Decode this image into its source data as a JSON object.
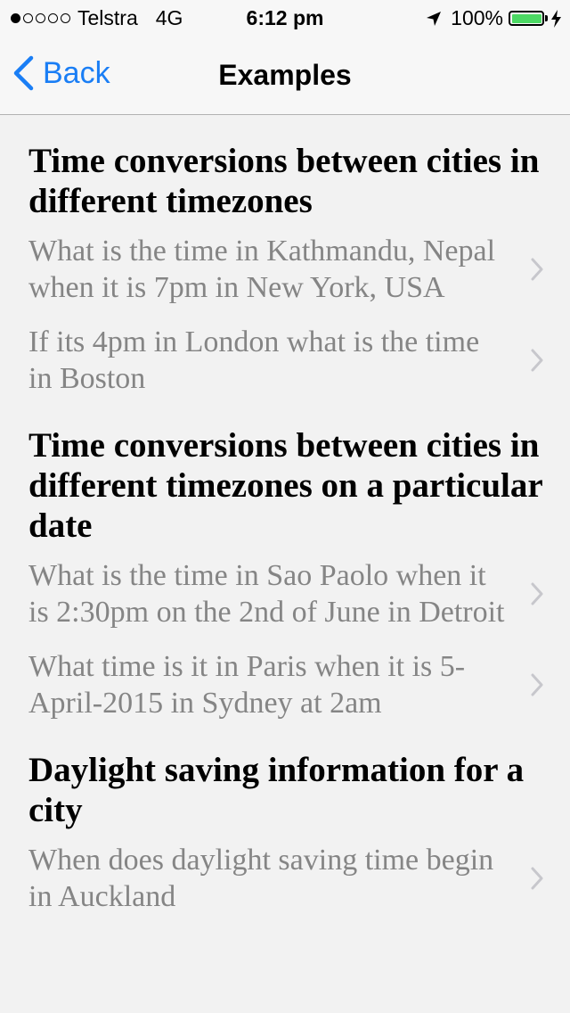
{
  "status_bar": {
    "carrier": "Telstra",
    "network": "4G",
    "time": "6:12 pm",
    "battery_percent": "100%",
    "battery_color": "#4cd964",
    "signal_filled": 1,
    "signal_total": 5
  },
  "nav": {
    "back_label": "Back",
    "title": "Examples",
    "accent_color": "#1a7ef5"
  },
  "sections": [
    {
      "title": "Time conversions between cities in different timezones",
      "examples": [
        "What is the time in Kathmandu, Nepal when it is 7pm in New York, USA",
        "If its 4pm in London what is the time in Boston"
      ]
    },
    {
      "title": "Time conversions between cities in different timezones on a particular date",
      "examples": [
        "What is the time in Sao Paolo when it is 2:30pm on the 2nd of June in Detroit",
        "What time is it in Paris when it is 5-April-2015 in Sydney at 2am"
      ]
    },
    {
      "title": "Daylight saving information for a city",
      "examples": [
        "When does daylight saving time begin in Auckland"
      ]
    }
  ]
}
